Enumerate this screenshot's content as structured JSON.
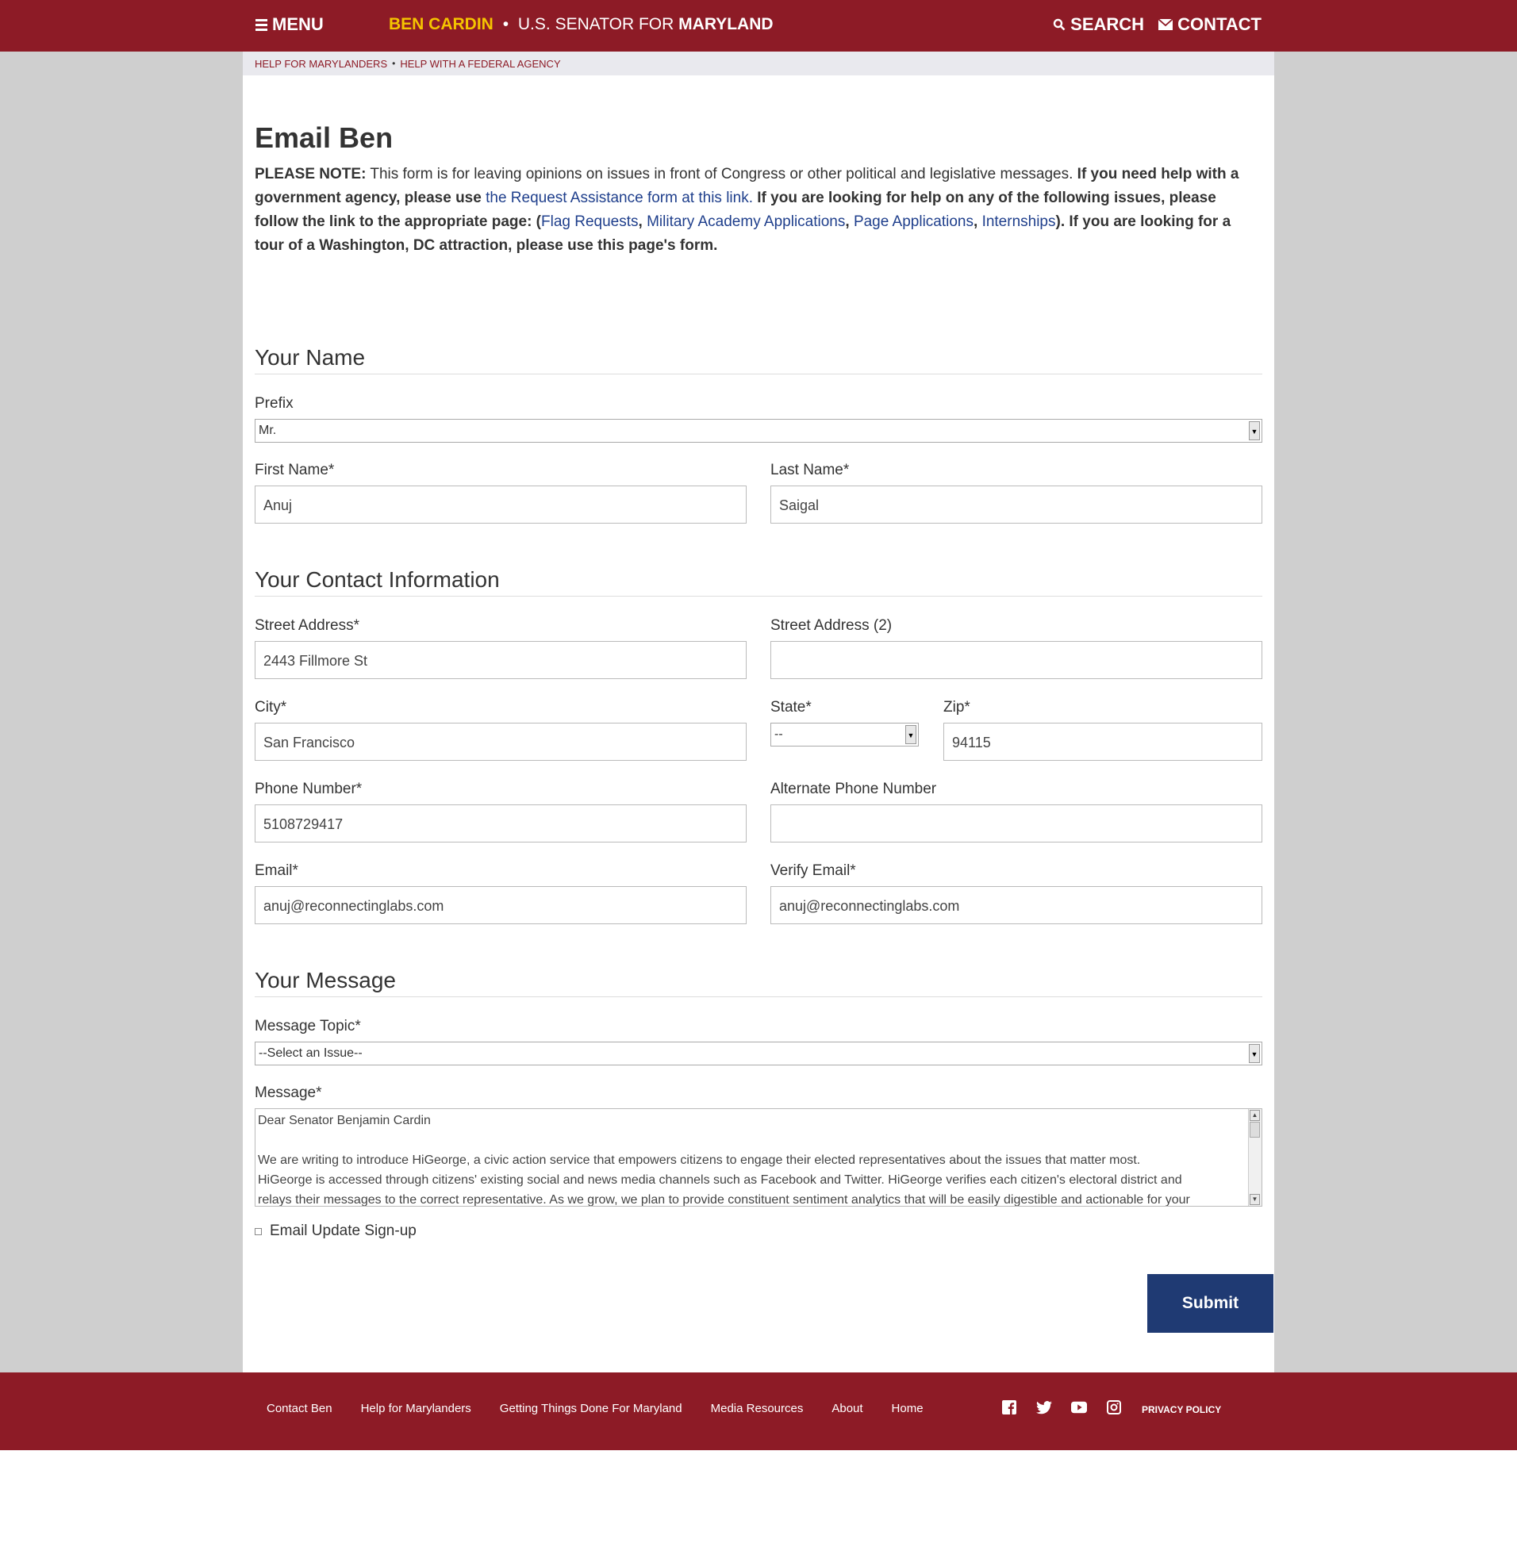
{
  "header": {
    "menu_label": "MENU",
    "brand_name": "BEN CARDIN",
    "brand_sep": "•",
    "brand_mid": "U.S. SENATOR FOR",
    "brand_state": "MARYLAND",
    "search_label": "SEARCH",
    "contact_label": "CONTACT"
  },
  "breadcrumb": {
    "items": [
      "HELP FOR MARYLANDERS",
      "HELP WITH A FEDERAL AGENCY"
    ],
    "sep": "•"
  },
  "page": {
    "title": "Email Ben",
    "note_label": "PLEASE NOTE:",
    "note_text": " This form is for leaving opinions on issues in front of Congress or other political and legislative messages. ",
    "note_bold1": "If you need help with a government agency, please use ",
    "note_link1": "the Request Assistance form at this link.",
    "note_bold2": " If you are looking for help on any of the following issues, please follow the link to the appropriate page: (",
    "links": [
      "Flag Requests",
      "Military Academy Applications",
      "Page Applications",
      "Internships"
    ],
    "note_bold3": "). If you are looking for a tour of a Washington, DC attraction, please use this page's form."
  },
  "sections": {
    "name": "Your Name",
    "contact": "Your Contact Information",
    "message": "Your Message"
  },
  "fields": {
    "prefix": {
      "label": "Prefix",
      "value": "Mr."
    },
    "first_name": {
      "label": "First Name*",
      "value": "Anuj"
    },
    "last_name": {
      "label": "Last Name*",
      "value": "Saigal"
    },
    "street": {
      "label": "Street Address*",
      "value": "2443 Fillmore St"
    },
    "street2": {
      "label": "Street Address (2)",
      "value": ""
    },
    "city": {
      "label": "City*",
      "value": "San Francisco"
    },
    "state": {
      "label": "State*",
      "value": "--"
    },
    "zip": {
      "label": "Zip*",
      "value": "94115"
    },
    "phone": {
      "label": "Phone Number*",
      "value": "5108729417"
    },
    "alt_phone": {
      "label": "Alternate Phone Number",
      "value": ""
    },
    "email": {
      "label": "Email*",
      "value": "anuj@reconnectinglabs.com"
    },
    "verify_email": {
      "label": "Verify Email*",
      "value": "anuj@reconnectinglabs.com"
    },
    "topic": {
      "label": "Message Topic*",
      "value": "--Select an Issue--"
    },
    "message": {
      "label": "Message*",
      "line1": "Dear Senator Benjamin Cardin",
      "line2": "We are writing to introduce HiGeorge, a civic action service that empowers citizens to engage their elected representatives about the issues that matter most.",
      "line3": "HiGeorge is accessed through citizens' existing social and news media channels such as Facebook and Twitter.  HiGeorge verifies each citizen's electoral district and",
      "line4": "relays their messages to the correct representative.  As we grow, we plan to provide constituent sentiment analytics that will be easily digestible and actionable for your"
    },
    "signup": {
      "label": "Email Update Sign-up"
    }
  },
  "submit_label": "Submit",
  "footer": {
    "links": [
      "Contact Ben",
      "Help for Marylanders",
      "Getting Things Done For Maryland",
      "Media Resources",
      "About",
      "Home"
    ],
    "privacy": "PRIVACY POLICY",
    "social_icons": [
      "facebook-icon",
      "twitter-icon",
      "youtube-icon",
      "instagram-icon"
    ]
  },
  "colors": {
    "brand_red": "#8d1b26",
    "brand_gold": "#f5c400",
    "link_blue": "#1f3f8c",
    "submit_blue": "#1f3a73"
  }
}
